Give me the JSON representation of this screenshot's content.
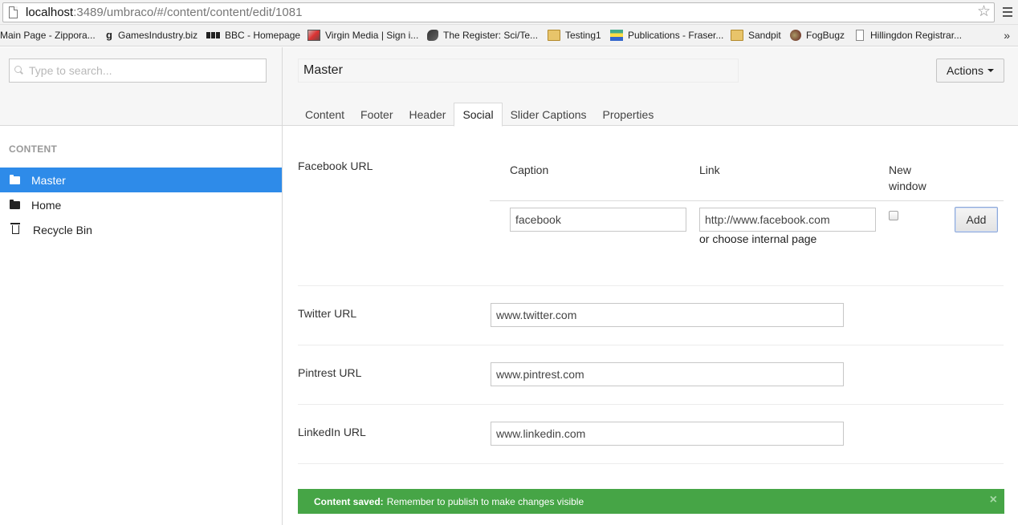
{
  "browser": {
    "url_host": "localhost",
    "url_rest": ":3489/umbraco/#/content/content/edit/1081",
    "bookmarks": [
      {
        "label": "Main Page - Zippora...",
        "icon": "none"
      },
      {
        "label": "GamesIndustry.biz",
        "icon": "gi-icon"
      },
      {
        "label": "BBC - Homepage",
        "icon": "bbc-icon"
      },
      {
        "label": "Virgin Media | Sign i...",
        "icon": "virgin-media-icon"
      },
      {
        "label": "The Register: Sci/Te...",
        "icon": "register-icon"
      },
      {
        "label": "Testing1",
        "icon": "folder-icon"
      },
      {
        "label": "Publications - Fraser...",
        "icon": "publications-icon"
      },
      {
        "label": "Sandpit",
        "icon": "folder-icon"
      },
      {
        "label": "FogBugz",
        "icon": "fogbugz-icon"
      },
      {
        "label": "Hillingdon Registrar...",
        "icon": "page-icon"
      }
    ],
    "more": "»"
  },
  "sidebar": {
    "search_placeholder": "Type to search...",
    "section_title": "CONTENT",
    "tree": [
      {
        "label": "Master",
        "icon": "folder-icon",
        "active": true
      },
      {
        "label": "Home",
        "icon": "folder-icon",
        "active": false
      },
      {
        "label": "Recycle Bin",
        "icon": "trash-icon",
        "active": false
      }
    ]
  },
  "editor": {
    "node_name": "Master",
    "actions_label": "Actions",
    "tabs": [
      {
        "label": "Content"
      },
      {
        "label": "Footer"
      },
      {
        "label": "Header"
      },
      {
        "label": "Social",
        "active": true
      },
      {
        "label": "Slider Captions"
      },
      {
        "label": "Properties"
      }
    ],
    "facebook": {
      "label": "Facebook URL",
      "col_caption": "Caption",
      "col_link": "Link",
      "col_new_window_1": "New",
      "col_new_window_2": "window",
      "caption_value": "facebook",
      "link_value": "http://www.facebook.com",
      "internal_link": "or choose internal page",
      "new_window_checked": false,
      "add_label": "Add"
    },
    "twitter": {
      "label": "Twitter URL",
      "value": "www.twitter.com"
    },
    "pintrest": {
      "label": "Pintrest URL",
      "value": "www.pintrest.com"
    },
    "linkedin": {
      "label": "LinkedIn URL",
      "value": "www.linkedin.com"
    }
  },
  "notification": {
    "strong": "Content saved:",
    "message": "Remember to publish to make changes visible",
    "close": "×",
    "color": "#46a546"
  },
  "colors": {
    "accent": "#2e8be9",
    "success": "#46a546"
  }
}
